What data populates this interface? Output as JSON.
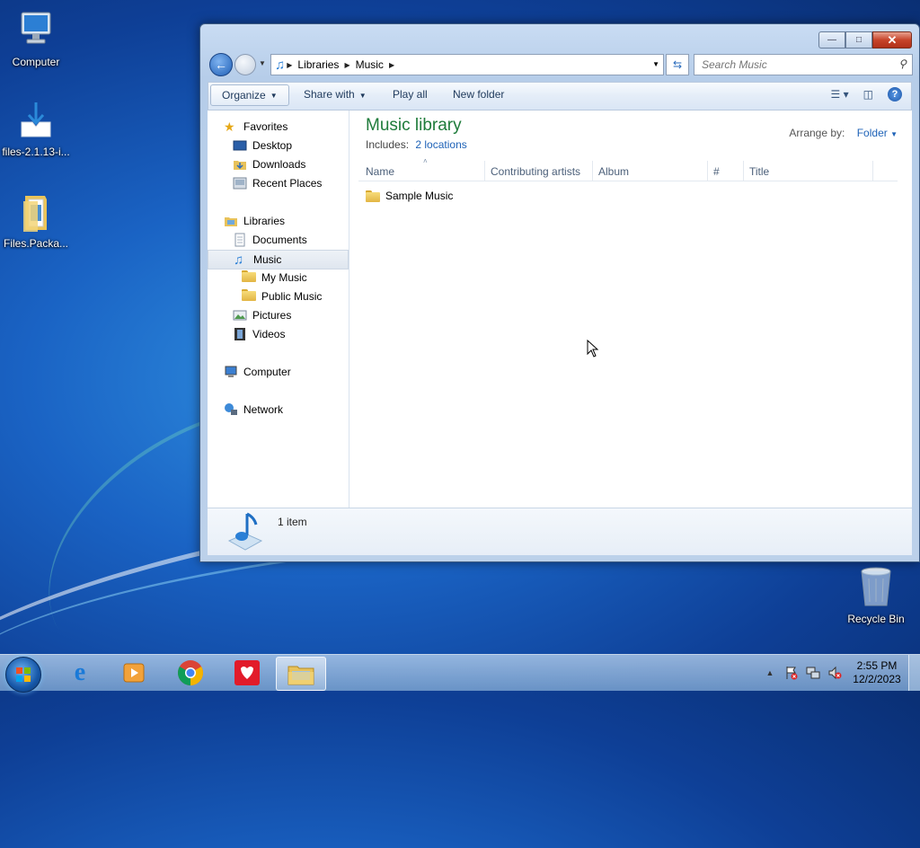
{
  "desktop": {
    "icons": [
      {
        "label": "Computer"
      },
      {
        "label": "files-2.1.13-i..."
      },
      {
        "label": "Files.Packa..."
      },
      {
        "label": "Recycle Bin"
      }
    ]
  },
  "window": {
    "breadcrumb": [
      "Libraries",
      "Music"
    ],
    "search_placeholder": "Search Music",
    "toolbar": {
      "organize": "Organize",
      "share_with": "Share with",
      "play_all": "Play all",
      "new_folder": "New folder"
    },
    "nav": {
      "favorites": "Favorites",
      "desktop": "Desktop",
      "downloads": "Downloads",
      "recent_places": "Recent Places",
      "libraries": "Libraries",
      "documents": "Documents",
      "music": "Music",
      "my_music": "My Music",
      "public_music": "Public Music",
      "pictures": "Pictures",
      "videos": "Videos",
      "computer": "Computer",
      "network": "Network"
    },
    "library": {
      "title": "Music library",
      "includes_label": "Includes:",
      "includes_link": "2 locations",
      "arrange_label": "Arrange by:",
      "arrange_value": "Folder"
    },
    "columns": [
      "Name",
      "Contributing artists",
      "Album",
      "#",
      "Title"
    ],
    "items": [
      {
        "name": "Sample Music"
      }
    ],
    "status": "1 item"
  },
  "taskbar": {
    "time": "2:55 PM",
    "date": "12/2/2023"
  },
  "colors": {
    "library_title": "#1e7b3a",
    "link": "#1e62b7"
  }
}
